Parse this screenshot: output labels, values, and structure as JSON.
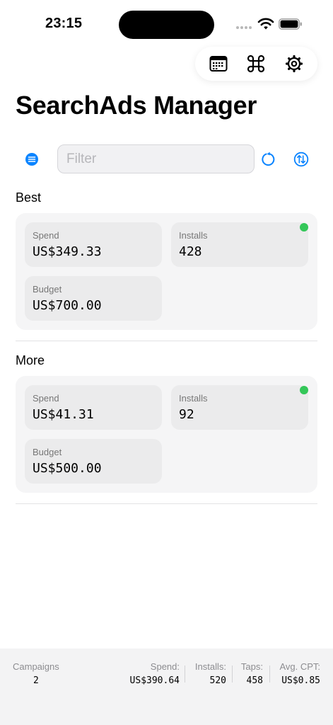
{
  "status_bar": {
    "time": "23:15"
  },
  "toolbar": {
    "calendar_icon": "calendar-icon",
    "command_icon": "command-icon",
    "settings_icon": "gear-icon"
  },
  "page": {
    "title": "SearchAds Manager"
  },
  "filter": {
    "placeholder": "Filter",
    "value": ""
  },
  "colors": {
    "accent": "#0a84ff",
    "status_active": "#34c759"
  },
  "sections": [
    {
      "header": "Best",
      "spend_label": "Spend",
      "spend_value": "US$349.33",
      "installs_label": "Installs",
      "installs_value": "428",
      "budget_label": "Budget",
      "budget_value": "US$700.00",
      "status": "active"
    },
    {
      "header": "More",
      "spend_label": "Spend",
      "spend_value": "US$41.31",
      "installs_label": "Installs",
      "installs_value": "92",
      "budget_label": "Budget",
      "budget_value": "US$500.00",
      "status": "active"
    }
  ],
  "footer": {
    "campaigns_label": "Campaigns",
    "campaigns_value": "2",
    "spend_label": "Spend:",
    "spend_value": "US$390.64",
    "installs_label": "Installs:",
    "installs_value": "520",
    "taps_label": "Taps:",
    "taps_value": "458",
    "avg_cpt_label": "Avg. CPT:",
    "avg_cpt_value": "US$0.85"
  }
}
